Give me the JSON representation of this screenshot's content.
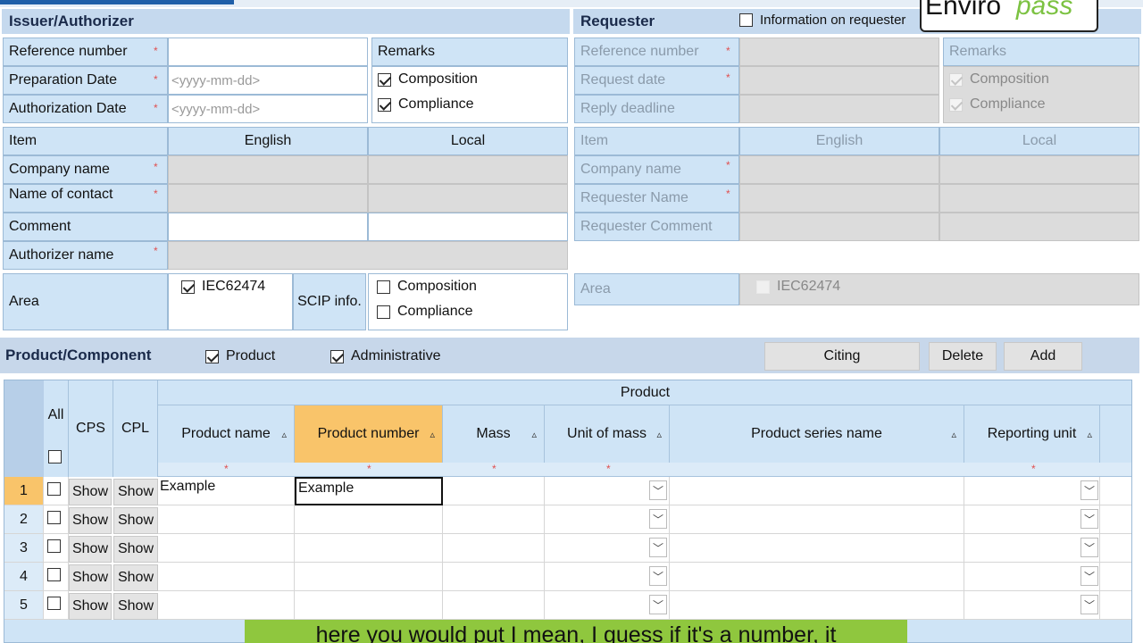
{
  "logo": {
    "part1": "Enviro",
    "part2": "pass"
  },
  "issuer": {
    "title": "Issuer/Authorizer",
    "reference_number": "Reference number",
    "preparation_date": "Preparation Date",
    "authorization_date": "Authorization Date",
    "date_placeholder": "<yyyy-mm-dd>",
    "remarks": "Remarks",
    "composition": "Composition",
    "compliance": "Compliance",
    "item": "Item",
    "english": "English",
    "local": "Local",
    "company_name": "Company name",
    "name_of_contact": "Name of contact",
    "comment": "Comment",
    "authorizer_name": "Authorizer name",
    "area": "Area",
    "iec": "IEC62474",
    "scip_info": "SCIP info."
  },
  "requester": {
    "title": "Requester",
    "info_label": "Information on requester",
    "reference_number": "Reference number",
    "request_date": "Request date",
    "reply_deadline": "Reply deadline",
    "remarks": "Remarks",
    "composition": "Composition",
    "compliance": "Compliance",
    "item": "Item",
    "english": "English",
    "local": "Local",
    "company_name": "Company name",
    "requester_name": "Requester Name",
    "requester_comment": "Requester Comment",
    "area": "Area",
    "iec": "IEC62474"
  },
  "product": {
    "title": "Product/Component",
    "product_chk": "Product",
    "administrative_chk": "Administrative",
    "btn_citing": "Citing",
    "btn_delete": "Delete",
    "btn_add": "Add"
  },
  "grid": {
    "group_header": "Product",
    "col_all": "All",
    "col_cps": "CPS",
    "col_cpl": "CPL",
    "col_product_name": "Product name",
    "col_product_number": "Product number",
    "col_mass": "Mass",
    "col_unit_of_mass": "Unit of mass",
    "col_product_series_name": "Product series name",
    "col_reporting_unit": "Reporting unit",
    "show": "Show",
    "rows": [
      {
        "num": "1",
        "product_name": "Example",
        "product_number": "Example"
      },
      {
        "num": "2",
        "product_name": "",
        "product_number": ""
      },
      {
        "num": "3",
        "product_name": "",
        "product_number": ""
      },
      {
        "num": "4",
        "product_name": "",
        "product_number": ""
      },
      {
        "num": "5",
        "product_name": "",
        "product_number": ""
      }
    ]
  },
  "caption": "here you would put I mean, I guess if it's a number, it"
}
